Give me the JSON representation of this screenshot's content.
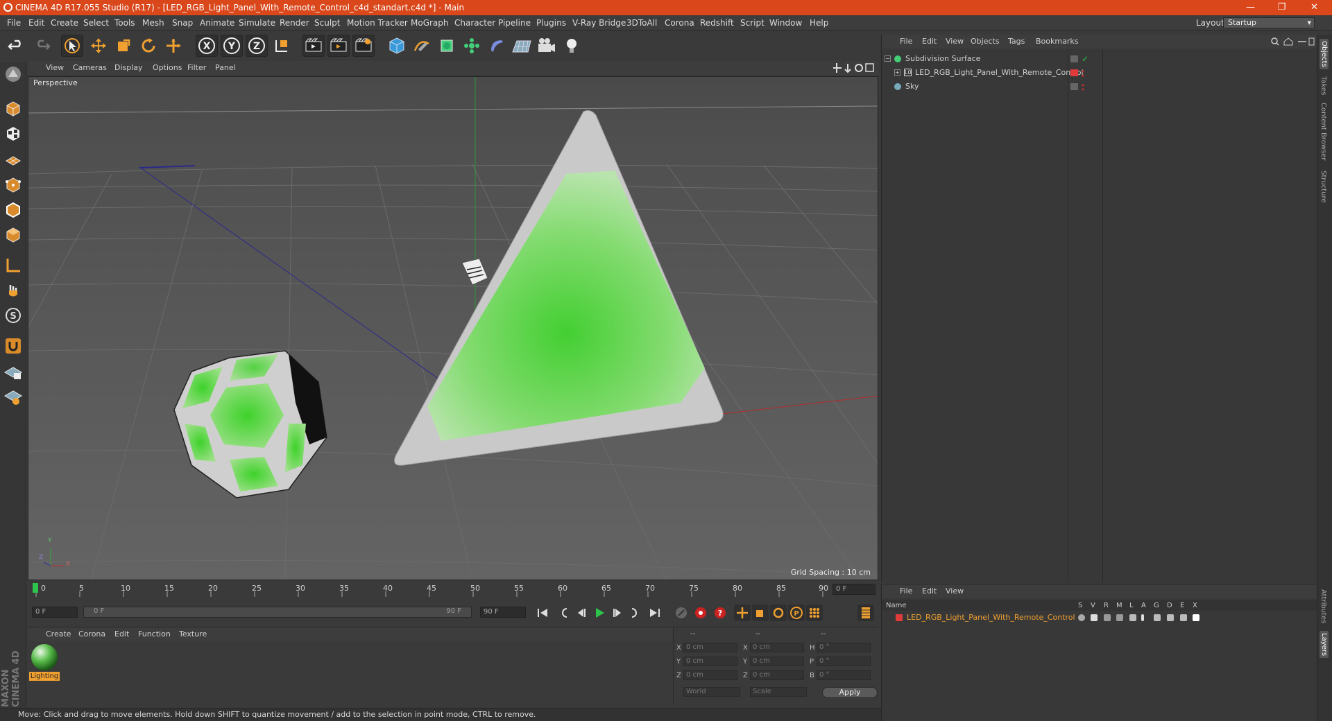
{
  "window": {
    "title": "CINEMA 4D R17.055 Studio (R17) - [LED_RGB_Light_Panel_With_Remote_Control_c4d_standart.c4d *] - Main",
    "minimize": "—",
    "restore": "❐",
    "close": "✕"
  },
  "menubar": {
    "items": [
      "File",
      "Edit",
      "Create",
      "Select",
      "Tools",
      "Mesh",
      "Snap",
      "Animate",
      "Simulate",
      "Render",
      "Sculpt",
      "Motion Tracker",
      "MoGraph",
      "Character",
      "Pipeline",
      "Plugins",
      "V-Ray Bridge",
      "3DToAll",
      "Corona",
      "Redshift",
      "Script",
      "Window",
      "Help"
    ],
    "layout_label": "Layout:",
    "layout_value": "Startup"
  },
  "viewport": {
    "menus": [
      "View",
      "Cameras",
      "Display",
      "Options",
      "Filter",
      "Panel"
    ],
    "label": "Perspective",
    "grid_spacing": "Grid Spacing : 10 cm",
    "axis_y": "Y",
    "axis_x": "X",
    "axis_z": "Z"
  },
  "timeline": {
    "ticks": [
      "0",
      "5",
      "10",
      "15",
      "20",
      "25",
      "30",
      "35",
      "40",
      "45",
      "50",
      "55",
      "60",
      "65",
      "70",
      "75",
      "80",
      "85",
      "90"
    ],
    "frame_end": "0 F"
  },
  "transport": {
    "start_field": "0 F",
    "range_start": "0 F",
    "range_end": "90 F",
    "end_field": "90 F"
  },
  "material_manager": {
    "menus": [
      "Create",
      "Corona",
      "Edit",
      "Function",
      "Texture"
    ],
    "material_name": "Lighting"
  },
  "coordinates": {
    "header": [
      "--",
      "--",
      "--"
    ],
    "rows": [
      {
        "l1": "X",
        "v1": "0 cm",
        "l2": "X",
        "v2": "0 cm",
        "l3": "H",
        "v3": "0 °"
      },
      {
        "l1": "Y",
        "v1": "0 cm",
        "l2": "Y",
        "v2": "0 cm",
        "l3": "P",
        "v3": "0 °"
      },
      {
        "l1": "Z",
        "v1": "0 cm",
        "l2": "Z",
        "v2": "0 cm",
        "l3": "B",
        "v3": "0 °"
      }
    ],
    "world": "World",
    "scale": "Scale",
    "apply": "Apply"
  },
  "object_manager": {
    "menus": [
      "File",
      "Edit",
      "View",
      "Objects",
      "Tags",
      "Bookmarks"
    ],
    "objects": [
      {
        "name": "Subdivision Surface"
      },
      {
        "name": "LED_RGB_Light_Panel_With_Remote_Control"
      },
      {
        "name": "Sky"
      }
    ]
  },
  "layer_manager": {
    "menus": [
      "File",
      "Edit",
      "View"
    ],
    "name_header": "Name",
    "columns": [
      "S",
      "V",
      "R",
      "M",
      "L",
      "A",
      "G",
      "D",
      "E",
      "X"
    ],
    "layer_name": "LED_RGB_Light_Panel_With_Remote_Control"
  },
  "right_tabs": [
    "Objects",
    "Takes",
    "Content Browser",
    "Structure",
    "Attributes",
    "Layers"
  ],
  "status": "Move: Click and drag to move elements. Hold down SHIFT to quantize movement / add to the selection in point mode, CTRL to remove.",
  "brand": "MAXON CINEMA 4D",
  "colors": {
    "title_bar": "#d9471a",
    "accent": "#f0a030",
    "layer_red": "#e03a3a"
  }
}
